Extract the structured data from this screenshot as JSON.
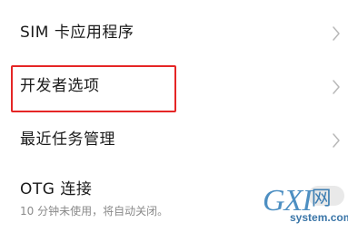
{
  "settings": {
    "items": [
      {
        "title": "SIM 卡应用程序"
      },
      {
        "title": "开发者选项"
      },
      {
        "title": "最近任务管理"
      },
      {
        "title": "OTG 连接",
        "subtitle": "10 分钟未使用，将自动关闭。"
      }
    ],
    "otg_toggle": {
      "state": "off"
    }
  },
  "watermark": {
    "logo": "GXI",
    "logo_cn": "网",
    "domain": "system.com"
  },
  "colors": {
    "highlight": "#e52626",
    "chevron": "#b8b8b8",
    "watermark": "#4d8fc2"
  },
  "icons": {
    "chevron": "chevron-right-icon"
  }
}
